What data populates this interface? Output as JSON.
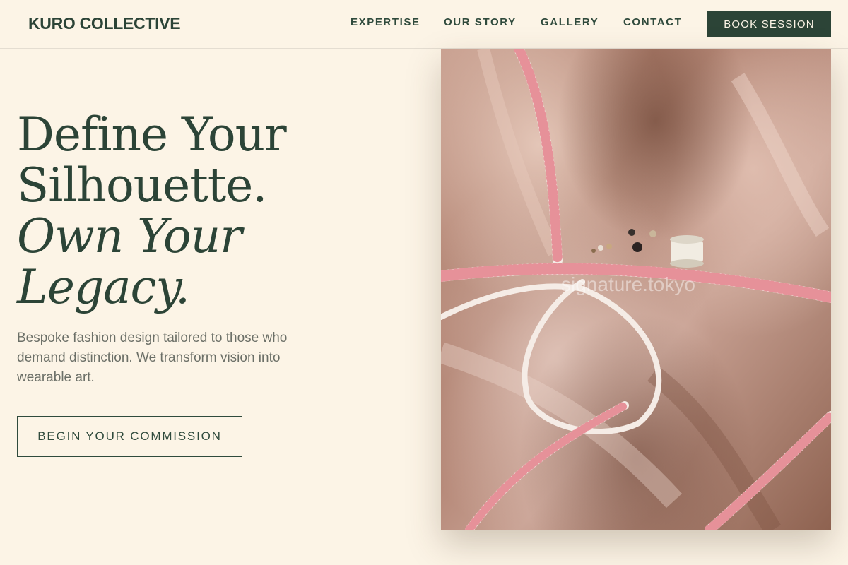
{
  "brand": {
    "name": "KURO COLLECTIVE"
  },
  "nav": {
    "items": [
      {
        "label": "EXPERTISE"
      },
      {
        "label": "OUR STORY"
      },
      {
        "label": "GALLERY"
      },
      {
        "label": "CONTACT"
      }
    ],
    "book_label": "BOOK SESSION"
  },
  "hero": {
    "title_line1": "Define Your",
    "title_line2": "Silhouette.",
    "title_line3": "Own Your",
    "title_line4": "Legacy.",
    "subtitle": "Bespoke fashion design tailored to those who demand distinction. We transform vision into wearable art.",
    "cta_label": "BEGIN YOUR COMMISSION"
  },
  "image": {
    "subject": "measuring tape on satin fabric with thread spool and buttons",
    "watermark": "signature.tokyo"
  },
  "colors": {
    "background": "#fcf4e6",
    "primary_green": "#2c4437",
    "body_text": "#6b6f67"
  }
}
